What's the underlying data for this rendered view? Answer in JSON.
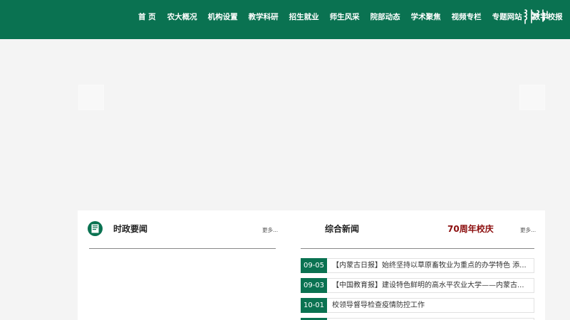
{
  "nav": {
    "items": [
      "首 页",
      "农大概况",
      "机构设置",
      "教学科研",
      "招生就业",
      "师生风采",
      "院部动态",
      "学术聚焦",
      "视频专栏",
      "专题网站",
      "数字校报"
    ]
  },
  "colors": {
    "brand_green": "#0a7251",
    "anniversary_red": "#8b0d0d"
  },
  "sections": {
    "current_affairs": {
      "title": "时政要闻",
      "more": "更多..."
    },
    "comprehensive_news": {
      "title": "综合新闻",
      "more": "更多..."
    },
    "anniversary": {
      "title": "70周年校庆"
    }
  },
  "news": [
    {
      "date": "09-05",
      "title": "【内蒙古日报】始终坚持以草原畜牧业为重点的办学特色 添..."
    },
    {
      "date": "09-03",
      "title": "【中国教育报】建设特色鲜明的高水平农业大学——内蒙古..."
    },
    {
      "date": "10-01",
      "title": "校领导督导检查疫情防控工作"
    }
  ],
  "icons": {
    "mongolian_script": "mongolian-script-icon",
    "section": "book-icon",
    "prev": "slider-prev-arrow",
    "next": "slider-next-arrow"
  }
}
